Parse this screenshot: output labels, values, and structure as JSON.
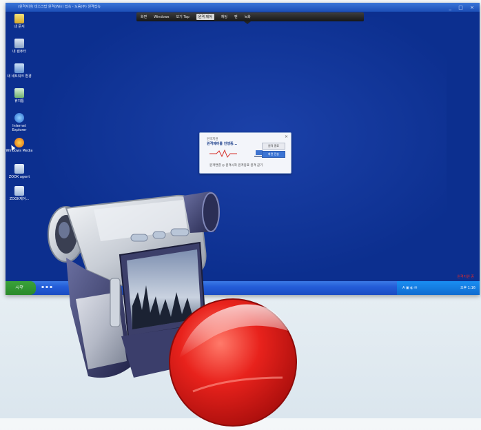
{
  "window": {
    "title": "(원격지원) 데스크탑 원격(Win) 접속 - 도움(주) 원격접속",
    "buttons": [
      "_",
      "□",
      "×"
    ]
  },
  "remote_toolbar": {
    "items": [
      "화면",
      "Windows",
      "보기 Top",
      "원격 제어",
      "채팅",
      "펜",
      "녹화"
    ],
    "active_item": "원격 제어"
  },
  "desktop_icons": [
    {
      "label": "내 문서",
      "icon": "folder-icon"
    },
    {
      "label": "내 컴퓨터",
      "icon": "computer-icon"
    },
    {
      "label": "내 네트워크 환경",
      "icon": "network-icon"
    },
    {
      "label": "휴지통",
      "icon": "trash-icon"
    },
    {
      "label": "Internet Explorer",
      "icon": "ie-icon"
    },
    {
      "label": "Windows Media",
      "icon": "media-icon"
    },
    {
      "label": "ZOOK agent",
      "icon": "app-icon"
    },
    {
      "label": "ZOOK제어...",
      "icon": "app-icon"
    }
  ],
  "dialog": {
    "title_small": "원격지원",
    "title_main": "원격제어를 진행중...",
    "btn_primary": "원격 종료",
    "btn_secondary": "화면 전송",
    "footer": "원격연결  ◎ 원격시작  원격종료  원격 끊기"
  },
  "taskbar": {
    "start_label": "시작",
    "tray_time": "오후 1:16",
    "corner_text": "원격지원 중"
  },
  "colors": {
    "desktop": "#0c2f8f",
    "taskbar": "#245dd8",
    "start": "#2f8f2f",
    "record": "#e8221c"
  }
}
